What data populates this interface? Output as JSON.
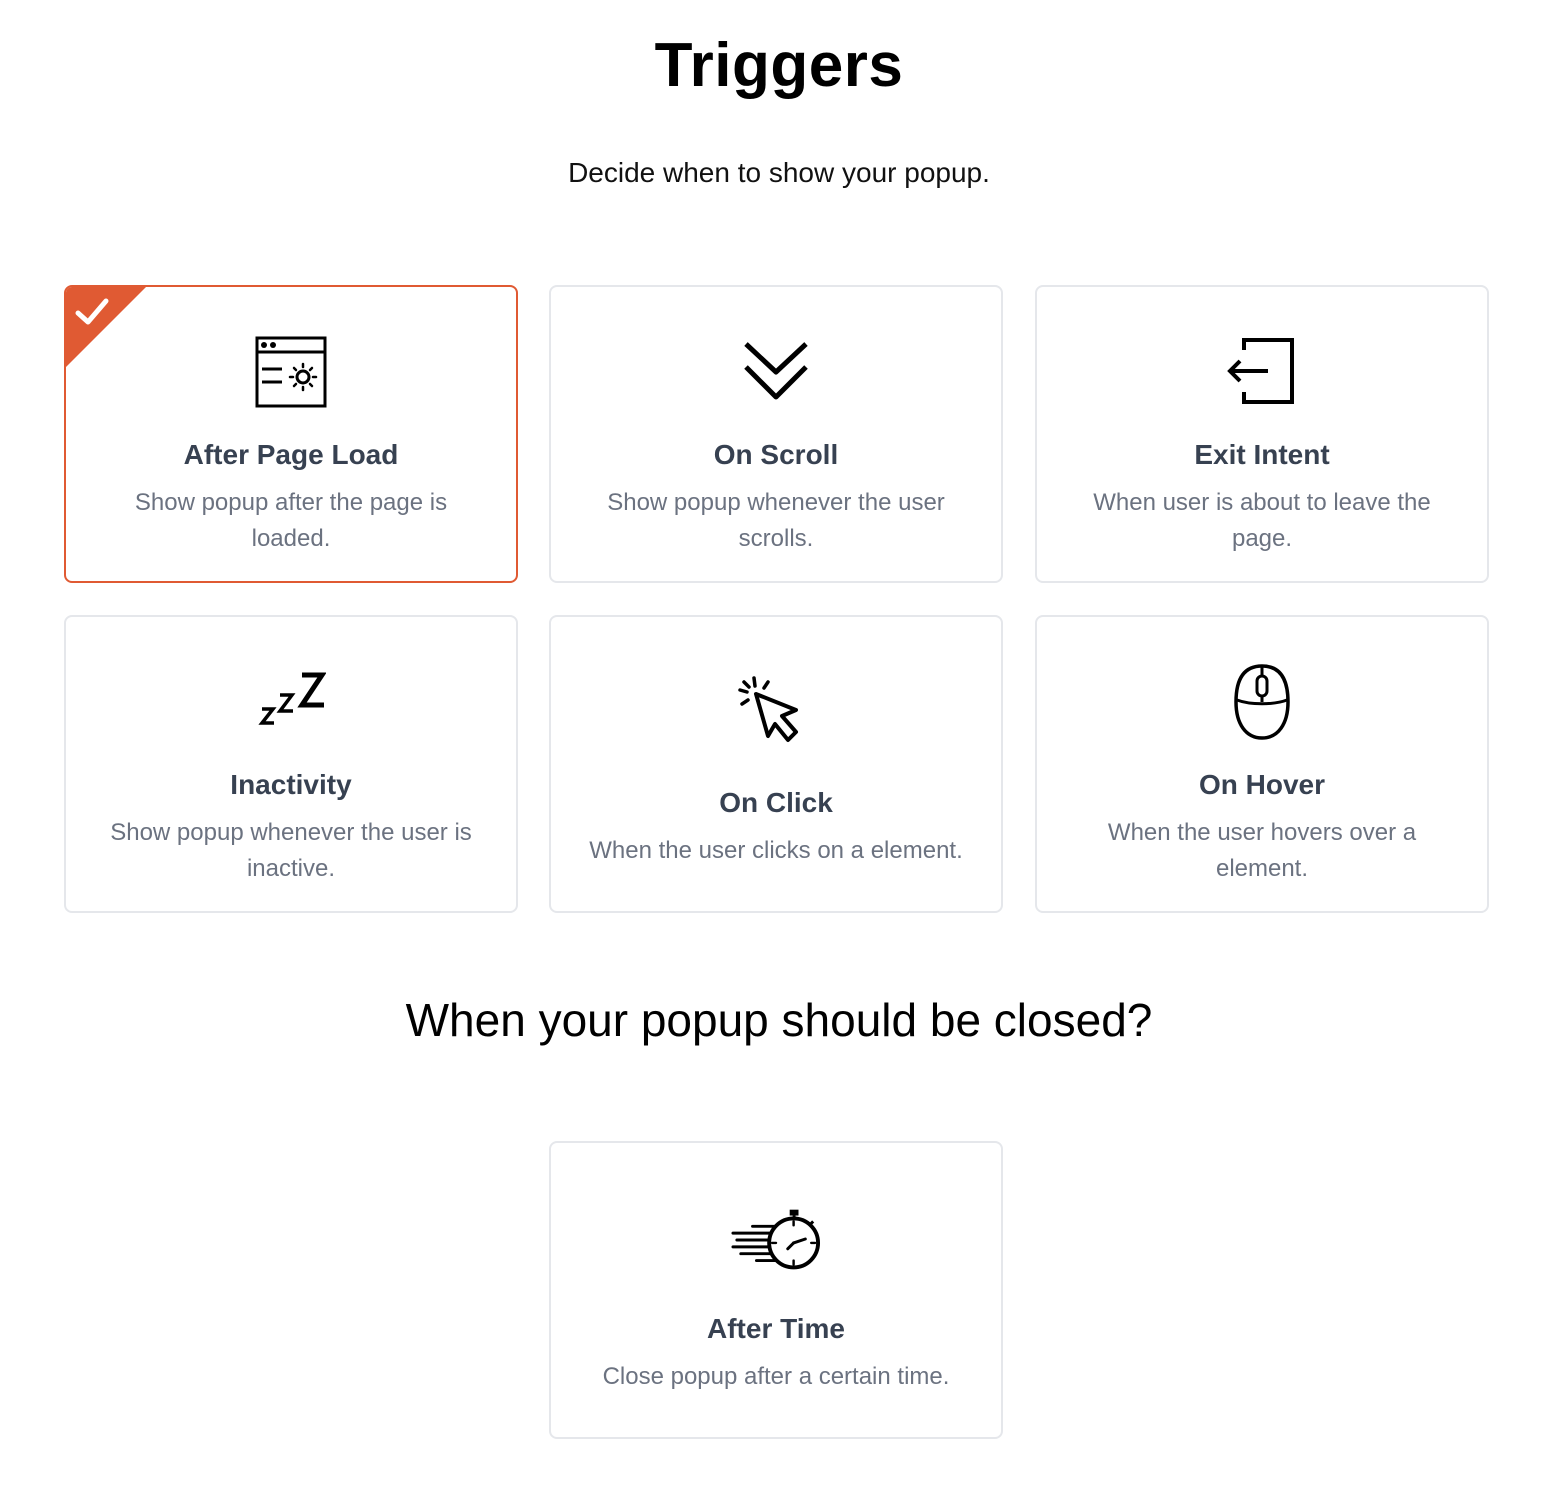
{
  "header": {
    "title": "Triggers",
    "subtitle": "Decide when to show your popup."
  },
  "triggers": [
    {
      "title": "After Page Load",
      "description": "Show popup after the page is loaded.",
      "icon": "browser-settings-icon",
      "selected": true
    },
    {
      "title": "On Scroll",
      "description": "Show popup whenever the user scrolls.",
      "icon": "double-chevron-down-icon",
      "selected": false
    },
    {
      "title": "Exit Intent",
      "description": "When user is about to leave the page.",
      "icon": "exit-icon",
      "selected": false
    },
    {
      "title": "Inactivity",
      "description": "Show popup whenever the user is inactive.",
      "icon": "sleep-zzz-icon",
      "selected": false
    },
    {
      "title": "On Click",
      "description": "When the user clicks on a element.",
      "icon": "cursor-click-icon",
      "selected": false
    },
    {
      "title": "On Hover",
      "description": "When the user hovers over a element.",
      "icon": "mouse-icon",
      "selected": false
    }
  ],
  "close_section": {
    "title": "When your popup should be closed?",
    "options": [
      {
        "title": "After Time",
        "description": "Close popup after a certain time.",
        "icon": "stopwatch-icon",
        "selected": false
      }
    ]
  },
  "colors": {
    "accent": "#e05a33",
    "card_border": "#e5e7eb",
    "card_title": "#374151",
    "card_desc": "#6b7280"
  }
}
